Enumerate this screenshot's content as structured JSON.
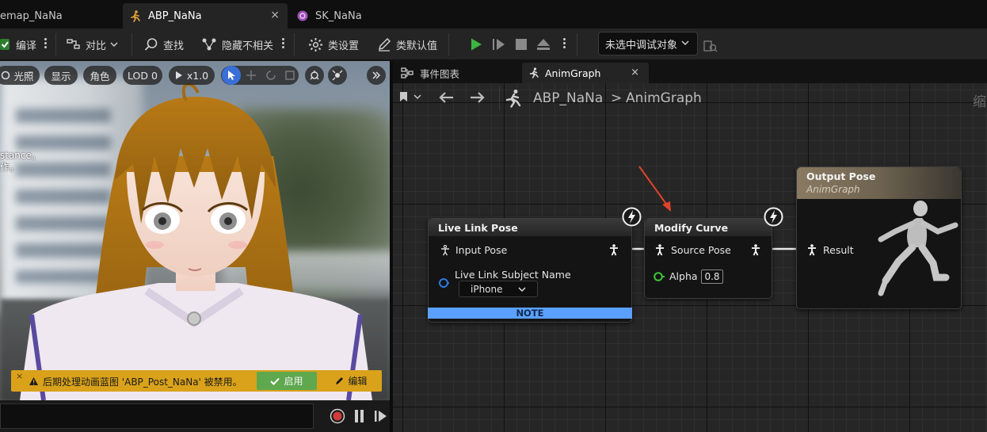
{
  "tabs": [
    {
      "label": "emap_NaNa"
    },
    {
      "label": "ABP_NaNa",
      "close": "×"
    },
    {
      "label": "SK_NaNa"
    }
  ],
  "toolbar": {
    "compile": "编译",
    "diff": "对比",
    "find": "查找",
    "hide_unrelated": "隐藏不相关",
    "class_settings": "类设置",
    "class_defaults": "类默认值",
    "debug_target": "未选中调试对象"
  },
  "viewport": {
    "lighting": "光照",
    "show": "显示",
    "character": "角色",
    "lod": "LOD 0",
    "speed": "x1.0",
    "overlay_line1": "stance。",
    "overlay_line2": "作。",
    "warning": "后期处理动画蓝图 'ABP_Post_NaNa' 被禁用。",
    "warning_close": "×",
    "enable": "启用",
    "edit": "编辑"
  },
  "graph": {
    "tabs": [
      {
        "label": "事件图表"
      },
      {
        "label": "AnimGraph",
        "close": "×"
      }
    ],
    "breadcrumb": {
      "root": "ABP_NaNa",
      "separator": ">",
      "current": "AnimGraph",
      "right_cut": "缩"
    },
    "nodes": {
      "live_link": {
        "title": "Live Link Pose",
        "input_pose": "Input Pose",
        "subject_label": "Live Link Subject Name",
        "subject_value": "iPhone",
        "note": "NOTE"
      },
      "modify_curve": {
        "title": "Modify Curve",
        "source_pose": "Source Pose",
        "alpha_label": "Alpha",
        "alpha_value": "0.8"
      },
      "output_pose": {
        "title": "Output Pose",
        "subtitle": "AnimGraph",
        "result": "Result"
      }
    }
  },
  "colors": {
    "accent_play": "#3fb342",
    "note": "#5ba0ff",
    "warning": "#d9a21a",
    "arrow": "#e0442c"
  }
}
